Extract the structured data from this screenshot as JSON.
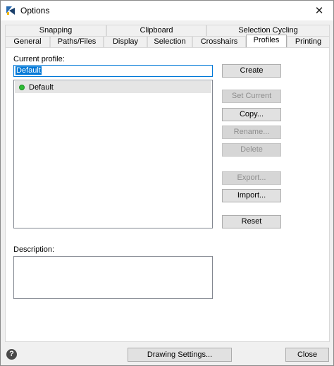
{
  "window": {
    "title": "Options",
    "close_glyph": "✕"
  },
  "tabs_row1": [
    {
      "label": "Snapping"
    },
    {
      "label": "Clipboard"
    },
    {
      "label": "Selection Cycling"
    }
  ],
  "tabs_row2": [
    {
      "label": "General"
    },
    {
      "label": "Paths/Files"
    },
    {
      "label": "Display"
    },
    {
      "label": "Selection"
    },
    {
      "label": "Crosshairs"
    },
    {
      "label": "Profiles"
    },
    {
      "label": "Printing"
    }
  ],
  "active_tab": "Profiles",
  "profiles": {
    "current_profile_label": "Current profile:",
    "current_profile_value": "Default",
    "list": [
      {
        "name": "Default",
        "status_color": "#2ebd35"
      }
    ],
    "description_label": "Description:",
    "description_value": ""
  },
  "buttons": {
    "create": "Create",
    "set_current": "Set Current",
    "copy": "Copy...",
    "rename": "Rename...",
    "delete": "Delete",
    "export": "Export...",
    "import": "Import...",
    "reset": "Reset"
  },
  "footer": {
    "help_glyph": "?",
    "drawing_settings": "Drawing Settings...",
    "close": "Close"
  },
  "colors": {
    "accent": "#0078d7",
    "app_icon_primary": "#2b6cb0",
    "app_icon_secondary": "#f2b705"
  },
  "icons": {
    "app": "app-logo-icon",
    "close": "close-icon",
    "help": "help-icon",
    "status": "green-dot-icon"
  }
}
